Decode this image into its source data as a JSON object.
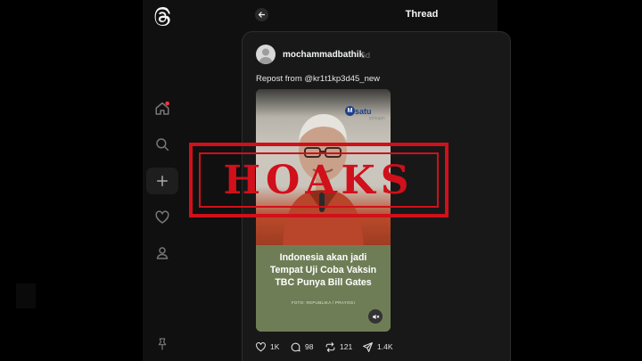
{
  "header": {
    "title": "Thread"
  },
  "post": {
    "username": "mochammadbathik",
    "time": "6d",
    "repost_text": "Repost from @kr1t1kp3d45_new",
    "media": {
      "brand": "satu",
      "brand_sub": "jaringan",
      "headline_line1": "Indonesia akan jadi",
      "headline_line2": "Tempat Uji Coba Vaksin",
      "headline_line3": "TBC Punya Bill Gates",
      "photo_credit": "FOTO: REPUBLIKA / PRAYOGI"
    },
    "actions": {
      "likes": "1K",
      "comments": "98",
      "reposts": "121",
      "shares": "1.4K"
    }
  },
  "stamp": {
    "text": "HOAKS",
    "color": "#d0101a"
  },
  "nav": {
    "icons": [
      "threads-logo-icon",
      "home-icon",
      "search-icon",
      "create-icon",
      "heart-icon",
      "profile-icon",
      "pin-icon"
    ]
  },
  "colors": {
    "background": "#000000",
    "panel": "#101010",
    "card": "#181818",
    "accent_notification": "#ff3040"
  }
}
